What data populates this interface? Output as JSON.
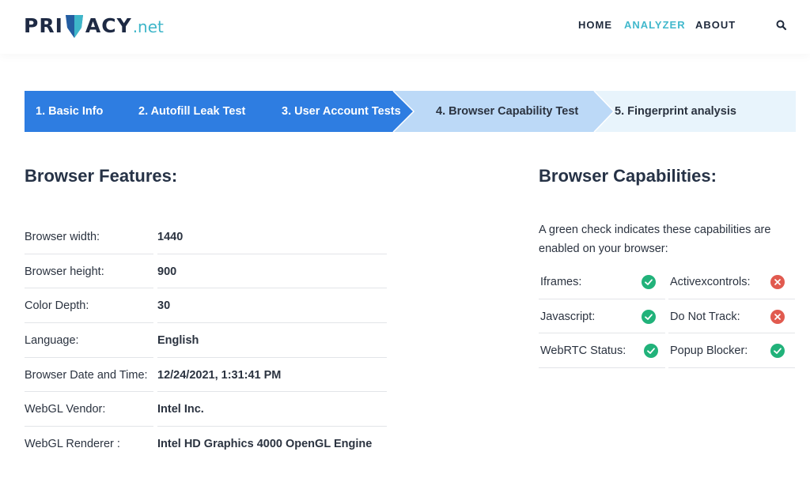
{
  "header": {
    "logo": {
      "part1": "PRI",
      "part2": "ACY",
      "suffix": ".net"
    },
    "nav": [
      "HOME",
      "ANALYZER",
      "ABOUT"
    ]
  },
  "steps": [
    "1. Basic Info",
    "2. Autofill Leak Test",
    "3. User Account Tests",
    "4. Browser Capability Test",
    "5. Fingerprint analysis"
  ],
  "features": {
    "heading": "Browser Features:",
    "rows": [
      {
        "label": "Browser width:",
        "value": "1440"
      },
      {
        "label": "Browser height:",
        "value": "900"
      },
      {
        "label": "Color Depth:",
        "value": "30"
      },
      {
        "label": "Language:",
        "value": "English"
      },
      {
        "label": "Browser Date and Time:",
        "value": "12/24/2021, 1:31:41 PM"
      },
      {
        "label": "WebGL Vendor:",
        "value": "Intel Inc."
      },
      {
        "label": "WebGL Renderer :",
        "value": "Intel HD Graphics 4000 OpenGL Engine"
      }
    ]
  },
  "capabilities": {
    "heading": "Browser Capabilities:",
    "description": "A green check indicates these capabilities are enabled on your browser:",
    "rows": [
      [
        {
          "label": "Iframes:",
          "status": "enabled"
        },
        {
          "label": "Activexcontrols:",
          "status": "disabled"
        }
      ],
      [
        {
          "label": "Javascript:",
          "status": "enabled"
        },
        {
          "label": "Do Not Track:",
          "status": "disabled"
        }
      ],
      [
        {
          "label": "WebRTC Status:",
          "status": "enabled"
        },
        {
          "label": "Popup Blocker:",
          "status": "enabled"
        }
      ]
    ]
  },
  "colors": {
    "accent": "#41b8cc",
    "step_active": "#2e7de1",
    "step_current": "#bcd9f7",
    "step_upcoming": "#e8f4fc",
    "check": "#21b27a",
    "cross": "#e15a4f"
  }
}
